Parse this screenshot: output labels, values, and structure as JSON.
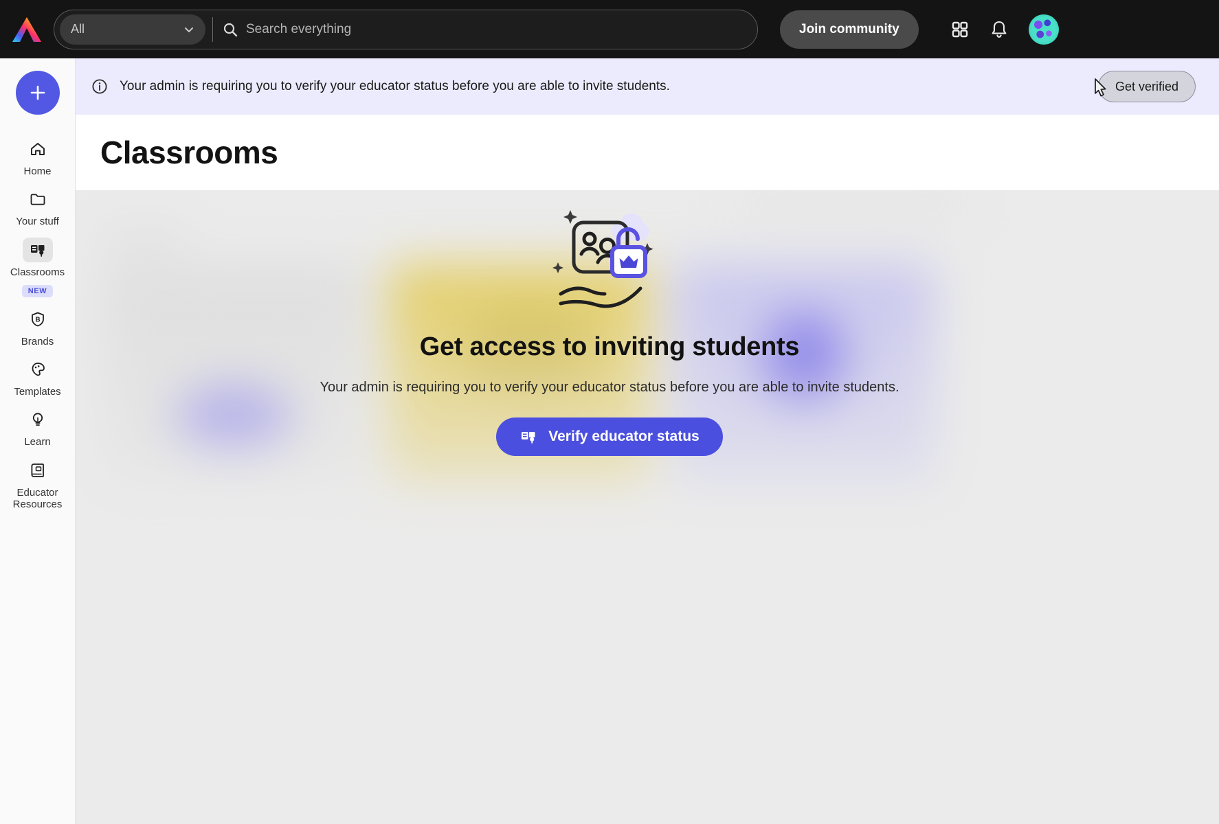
{
  "header": {
    "logo_name": "adobe-express-logo",
    "search_scope_value": "All",
    "search_placeholder": "Search everything",
    "search_value": "",
    "join_community_label": "Join community",
    "apps_icon": "grid-apps-icon",
    "notifications_icon": "bell-icon",
    "avatar_name": "user-avatar"
  },
  "sidebar": {
    "create_label": "+",
    "items": [
      {
        "label": "Home",
        "icon": "home-icon",
        "active": false,
        "badge": ""
      },
      {
        "label": "Your stuff",
        "icon": "folder-icon",
        "active": false,
        "badge": ""
      },
      {
        "label": "Classrooms",
        "icon": "classrooms-icon",
        "active": true,
        "badge": "NEW"
      },
      {
        "label": "Brands",
        "icon": "brand-shield-icon",
        "active": false,
        "badge": ""
      },
      {
        "label": "Templates",
        "icon": "templates-icon",
        "active": false,
        "badge": ""
      },
      {
        "label": "Learn",
        "icon": "lightbulb-icon",
        "active": false,
        "badge": ""
      },
      {
        "label": "Educator Resources",
        "icon": "book-icon",
        "active": false,
        "badge": ""
      }
    ]
  },
  "banner": {
    "icon": "info-circle-icon",
    "message": "Your admin is requiring you to verify your educator status before you are able to invite students.",
    "action_label": "Get verified",
    "background_color": "#ecebfd"
  },
  "page": {
    "title": "Classrooms"
  },
  "promo": {
    "illustration": "hand-holding-classroom-unlock-illustration",
    "title": "Get access to inviting students",
    "subtitle": "Your admin is requiring you to verify your educator status before you are able to invite students.",
    "cta_label": "Verify educator status",
    "cta_icon": "classrooms-icon",
    "cta_color": "#4b4fdf"
  },
  "background_cards": [
    {
      "name": "classroom-card-1",
      "color": "#d9d9d9",
      "accent": "#5b50e8"
    },
    {
      "name": "classroom-card-2",
      "color": "#e0c12c",
      "accent": "#c9a908"
    },
    {
      "name": "classroom-card-3",
      "color": "#b9b6ef",
      "accent": "#3a2ce8"
    }
  ],
  "colors": {
    "topbar": "#141414",
    "accent": "#5258e4",
    "banner": "#ecebfd",
    "content_bg": "#ebebeb"
  }
}
